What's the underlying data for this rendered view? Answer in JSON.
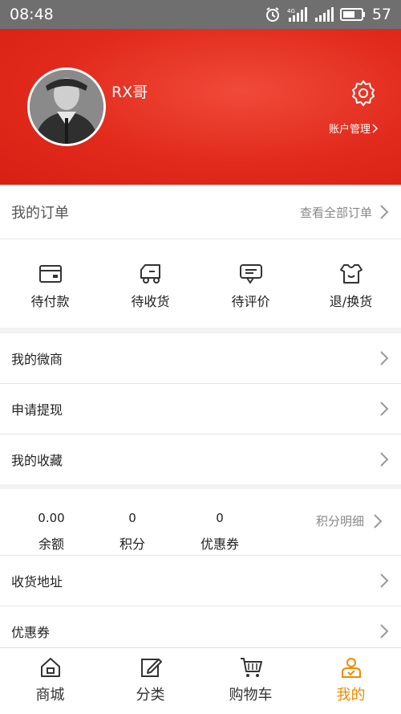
{
  "status_bar": {
    "time": "08:48",
    "network": "4G",
    "battery": "57"
  },
  "profile": {
    "username": "RX哥",
    "account_manage": "账户管理"
  },
  "orders": {
    "title": "我的订单",
    "view_all": "查看全部订单",
    "statuses": [
      {
        "label": "待付款",
        "icon": "wallet-icon"
      },
      {
        "label": "待收货",
        "icon": "truck-icon"
      },
      {
        "label": "待评价",
        "icon": "comment-icon"
      },
      {
        "label": "退/换货",
        "icon": "return-icon"
      }
    ]
  },
  "menu1": [
    {
      "label": "我的微商"
    },
    {
      "label": "申请提现"
    },
    {
      "label": "我的收藏"
    }
  ],
  "stats": {
    "balance": {
      "value": "0.00",
      "label": "余额"
    },
    "points": {
      "value": "0",
      "label": "积分"
    },
    "coupons": {
      "value": "0",
      "label": "优惠券"
    },
    "points_detail": "积分明细"
  },
  "menu2": [
    {
      "label": "收货地址"
    },
    {
      "label": "优惠券"
    }
  ],
  "tabs": [
    {
      "label": "商城",
      "icon": "home-icon"
    },
    {
      "label": "分类",
      "icon": "edit-icon"
    },
    {
      "label": "购物车",
      "icon": "cart-icon"
    },
    {
      "label": "我的",
      "icon": "user-icon",
      "active": true
    }
  ],
  "colors": {
    "header_red": "#e12a1c",
    "active_tab": "#f08a00"
  }
}
